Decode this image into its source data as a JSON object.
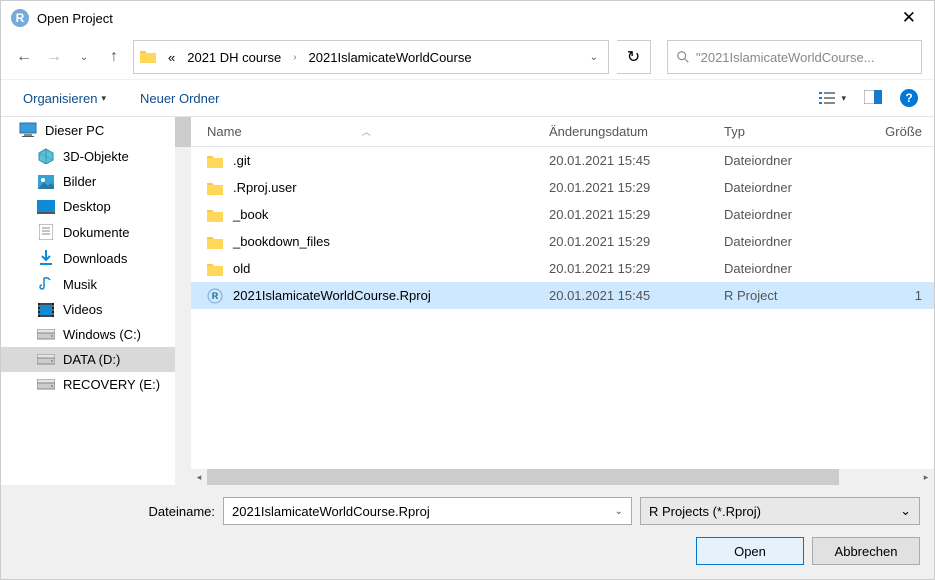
{
  "title": "Open Project",
  "breadcrumb": {
    "root": "«",
    "parent": "2021 DH course",
    "current": "2021IslamicateWorldCourse"
  },
  "search_placeholder": "\"2021IslamicateWorldCourse...",
  "toolbar": {
    "organize": "Organisieren",
    "new_folder": "Neuer Ordner"
  },
  "columns": {
    "name": "Name",
    "date": "Änderungsdatum",
    "type": "Typ",
    "size": "Größe"
  },
  "sidebar": [
    {
      "label": "Dieser PC",
      "icon": "pc",
      "indent": false,
      "selected": false
    },
    {
      "label": "3D-Objekte",
      "icon": "3d",
      "indent": true,
      "selected": false
    },
    {
      "label": "Bilder",
      "icon": "pictures",
      "indent": true,
      "selected": false
    },
    {
      "label": "Desktop",
      "icon": "desktop",
      "indent": true,
      "selected": false
    },
    {
      "label": "Dokumente",
      "icon": "documents",
      "indent": true,
      "selected": false
    },
    {
      "label": "Downloads",
      "icon": "downloads",
      "indent": true,
      "selected": false
    },
    {
      "label": "Musik",
      "icon": "music",
      "indent": true,
      "selected": false
    },
    {
      "label": "Videos",
      "icon": "videos",
      "indent": true,
      "selected": false
    },
    {
      "label": "Windows (C:)",
      "icon": "drive",
      "indent": true,
      "selected": false
    },
    {
      "label": "DATA (D:)",
      "icon": "drive",
      "indent": true,
      "selected": true
    },
    {
      "label": "RECOVERY (E:)",
      "icon": "drive",
      "indent": true,
      "selected": false
    }
  ],
  "files": [
    {
      "name": ".git",
      "date": "20.01.2021 15:45",
      "type": "Dateiordner",
      "size": "",
      "icon": "folder",
      "selected": false
    },
    {
      "name": ".Rproj.user",
      "date": "20.01.2021 15:29",
      "type": "Dateiordner",
      "size": "",
      "icon": "folder",
      "selected": false
    },
    {
      "name": "_book",
      "date": "20.01.2021 15:29",
      "type": "Dateiordner",
      "size": "",
      "icon": "folder",
      "selected": false
    },
    {
      "name": "_bookdown_files",
      "date": "20.01.2021 15:29",
      "type": "Dateiordner",
      "size": "",
      "icon": "folder",
      "selected": false
    },
    {
      "name": "old",
      "date": "20.01.2021 15:29",
      "type": "Dateiordner",
      "size": "",
      "icon": "folder",
      "selected": false
    },
    {
      "name": "2021IslamicateWorldCourse.Rproj",
      "date": "20.01.2021 15:45",
      "type": "R Project",
      "size": "1",
      "icon": "rproj",
      "selected": true
    }
  ],
  "footer": {
    "filename_label": "Dateiname:",
    "filename_value": "2021IslamicateWorldCourse.Rproj",
    "filter": "R Projects (*.Rproj)",
    "open": "Open",
    "cancel": "Abbrechen"
  }
}
